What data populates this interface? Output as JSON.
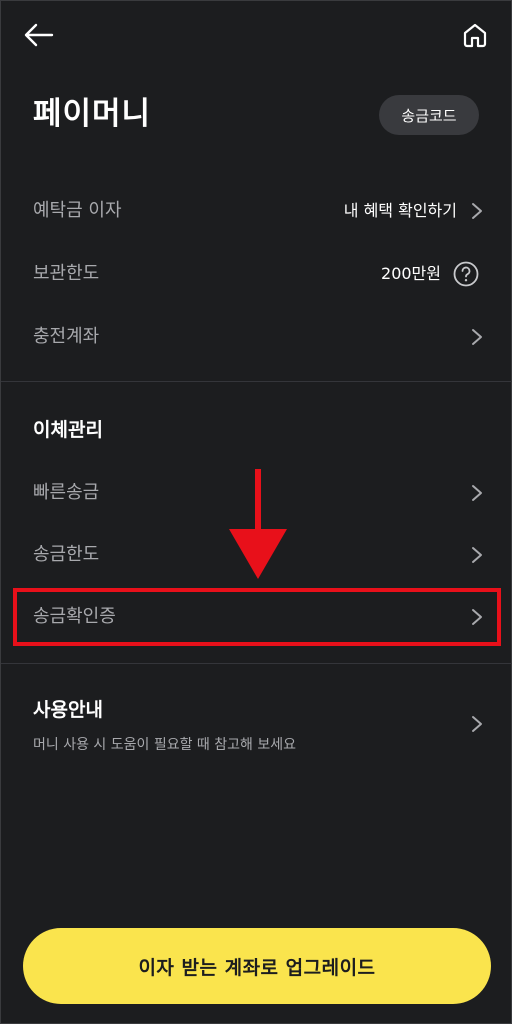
{
  "header": {
    "back_icon": "arrow-left-icon",
    "home_icon": "home-icon"
  },
  "title": {
    "text": "페이머니",
    "code_button_label": "송금코드"
  },
  "info_rows": [
    {
      "label": "예탁금 이자",
      "value": "내 혜택 확인하기",
      "icon": "chevron-right-icon"
    },
    {
      "label": "보관한도",
      "value": "200만원",
      "icon": "question-circle-icon"
    },
    {
      "label": "충전계좌",
      "value": "",
      "icon": "chevron-right-icon"
    }
  ],
  "transfer_section": {
    "title": "이체관리",
    "items": [
      {
        "label": "빠른송금",
        "icon": "chevron-right-icon"
      },
      {
        "label": "송금한도",
        "icon": "chevron-right-icon"
      },
      {
        "label": "송금확인증",
        "icon": "chevron-right-icon",
        "highlighted": true
      }
    ]
  },
  "guide": {
    "title": "사용안내",
    "subtitle": "머니 사용 시 도움이 필요할 때 참고해 보세요",
    "icon": "chevron-right-icon"
  },
  "cta": {
    "label": "이자 받는 계좌로 업그레이드"
  },
  "colors": {
    "background": "#1c1d1f",
    "accent_yellow": "#fae44d",
    "highlight_red": "#e8101a",
    "muted_text": "#a8a9ad"
  }
}
